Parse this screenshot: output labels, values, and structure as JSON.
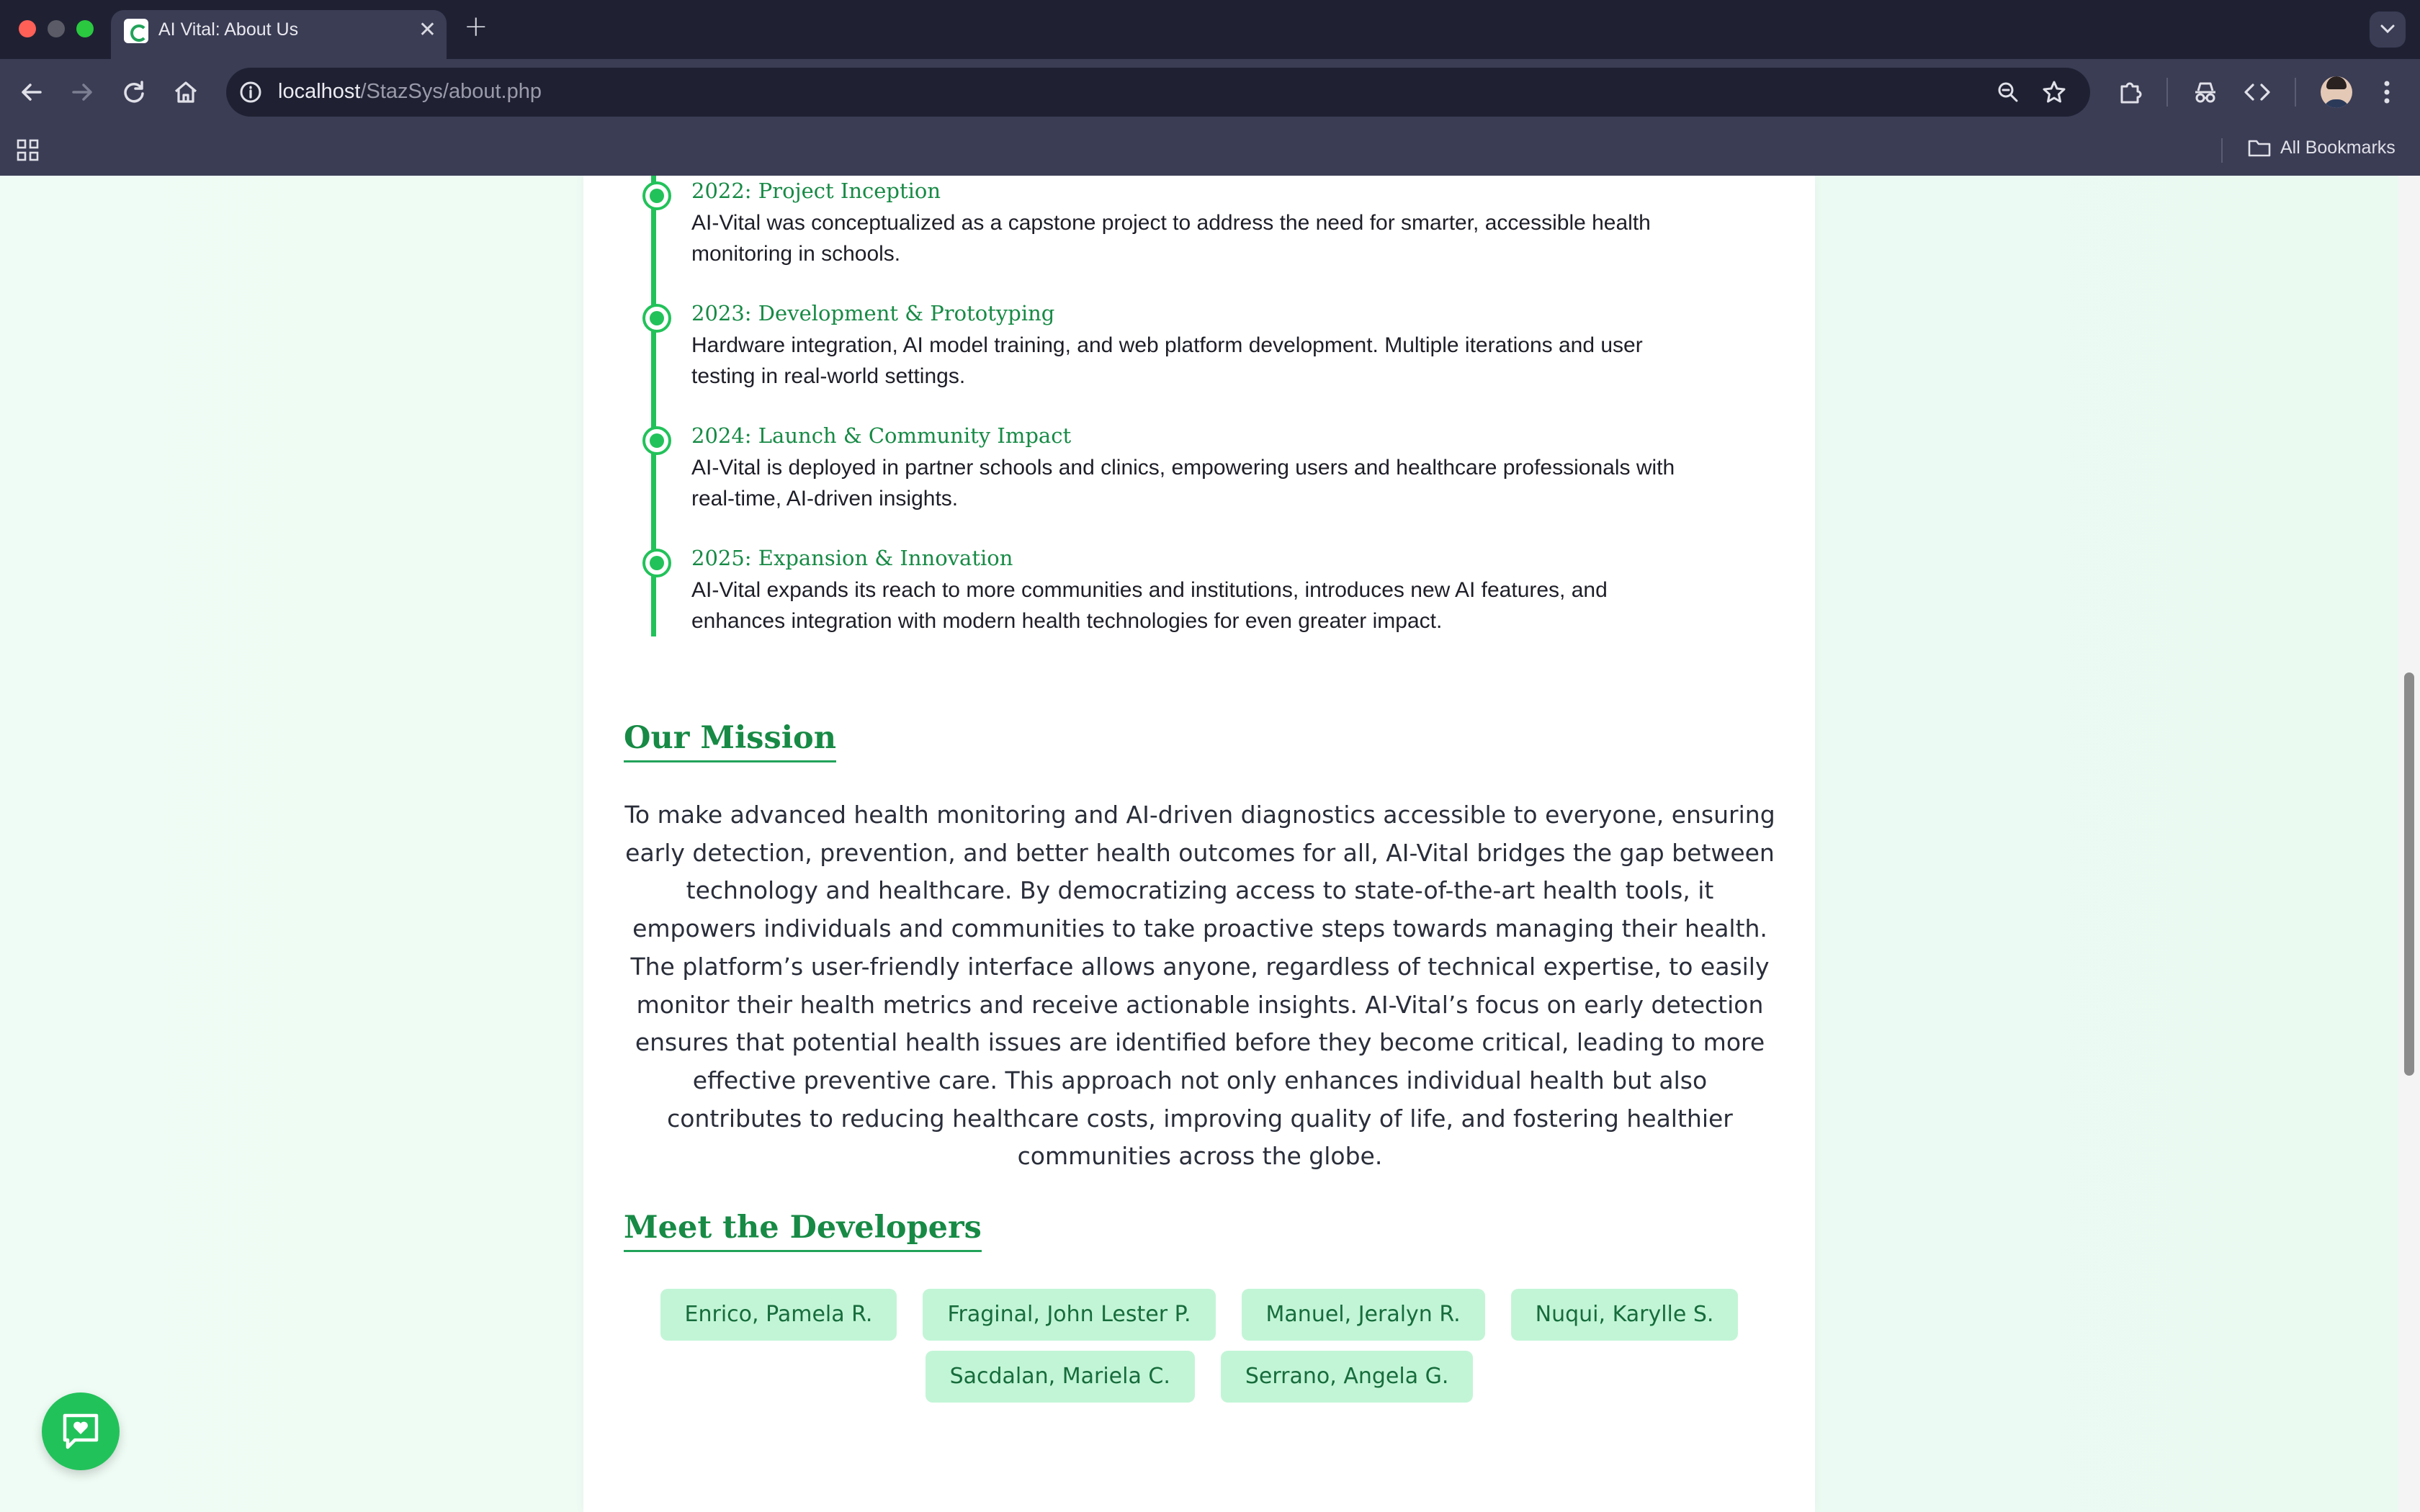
{
  "browser": {
    "tab_title": "AI Vital: About Us",
    "url_host": "localhost",
    "url_path": "/StazSys/about.php",
    "bookmarks_label": "All Bookmarks"
  },
  "timeline": [
    {
      "title": "2022: Project Inception",
      "description": "AI-Vital was conceptualized as a capstone project to address the need for smarter, accessible health monitoring in schools."
    },
    {
      "title": "2023: Development & Prototyping",
      "description": "Hardware integration, AI model training, and web platform development. Multiple iterations and user testing in real-world settings."
    },
    {
      "title": "2024: Launch & Community Impact",
      "description": "AI-Vital is deployed in partner schools and clinics, empowering users and healthcare professionals with real-time, AI-driven insights."
    },
    {
      "title": "2025: Expansion & Innovation",
      "description": "AI-Vital expands its reach to more communities and institutions, introduces new AI features, and enhances integration with modern health technologies for even greater impact."
    }
  ],
  "mission": {
    "title": "Our Mission",
    "text": "To make advanced health monitoring and AI-driven diagnostics accessible to everyone, ensuring early detection, prevention, and better health outcomes for all, AI-Vital bridges the gap between technology and healthcare. By democratizing access to state-of-the-art health tools, it empowers individuals and communities to take proactive steps towards managing their health. The platform’s user-friendly interface allows anyone, regardless of technical expertise, to easily monitor their health metrics and receive actionable insights. AI-Vital’s focus on early detection ensures that potential health issues are identified before they become critical, leading to more effective preventive care. This approach not only enhances individual health but also contributes to reducing healthcare costs, improving quality of life, and fostering healthier communities across the globe."
  },
  "developers": {
    "title": "Meet the Developers",
    "names": [
      "Enrico, Pamela R.",
      "Fraginal, John Lester P.",
      "Manuel, Jeralyn R.",
      "Nuqui, Karylle S.",
      "Sacdalan, Mariela C.",
      "Serrano, Angela G."
    ]
  },
  "colors": {
    "accent_green": "#22c25a",
    "heading_green": "#178a45",
    "chip_bg": "#c2f5d6",
    "chrome_dark": "#1f2133",
    "chrome_toolbar": "#3b3d55"
  }
}
